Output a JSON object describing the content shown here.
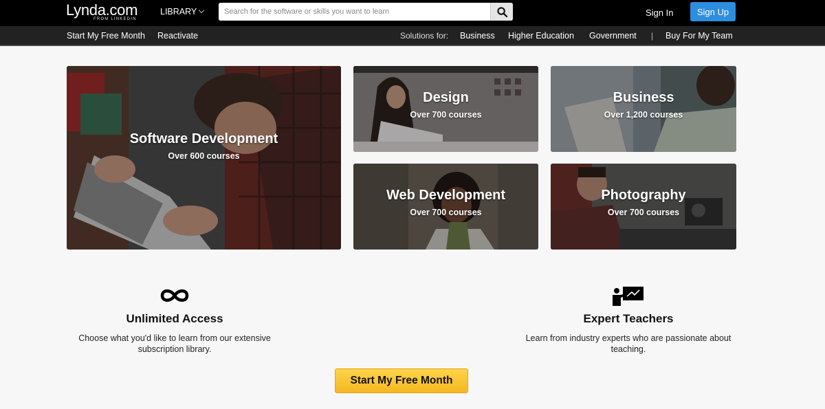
{
  "header": {
    "logo": "Lynda.com",
    "logo_sub": "FROM LINKEDIN",
    "library": "LIBRARY",
    "search_placeholder": "Search for the software or skills you want to learn",
    "sign_in": "Sign In",
    "sign_up": "Sign Up"
  },
  "subnav": {
    "free_month": "Start My Free Month",
    "reactivate": "Reactivate",
    "solutions_label": "Solutions for:",
    "solutions": [
      "Business",
      "Higher Education",
      "Government"
    ],
    "separator": "|",
    "team": "Buy For My Team"
  },
  "tiles": [
    {
      "title": "Software Development",
      "sub": "Over 600 courses"
    },
    {
      "title": "Design",
      "sub": "Over 700 courses"
    },
    {
      "title": "Business",
      "sub": "Over 1,200 courses"
    },
    {
      "title": "Web Development",
      "sub": "Over 700 courses"
    },
    {
      "title": "Photography",
      "sub": "Over 700 courses"
    }
  ],
  "features": [
    {
      "title": "Unlimited Access",
      "text": "Choose what you'd like to learn from our extensive subscription library.",
      "icon": "infinity-icon"
    },
    {
      "title": "Expert Teachers",
      "text": "Learn from industry experts who are passionate about teaching.",
      "icon": "teacher-icon"
    }
  ],
  "cta": "Start My Free Month",
  "colors": {
    "signup": "#2e8ede",
    "cta": "#f5b821",
    "topbar": "#000000",
    "subbar": "#222222"
  }
}
